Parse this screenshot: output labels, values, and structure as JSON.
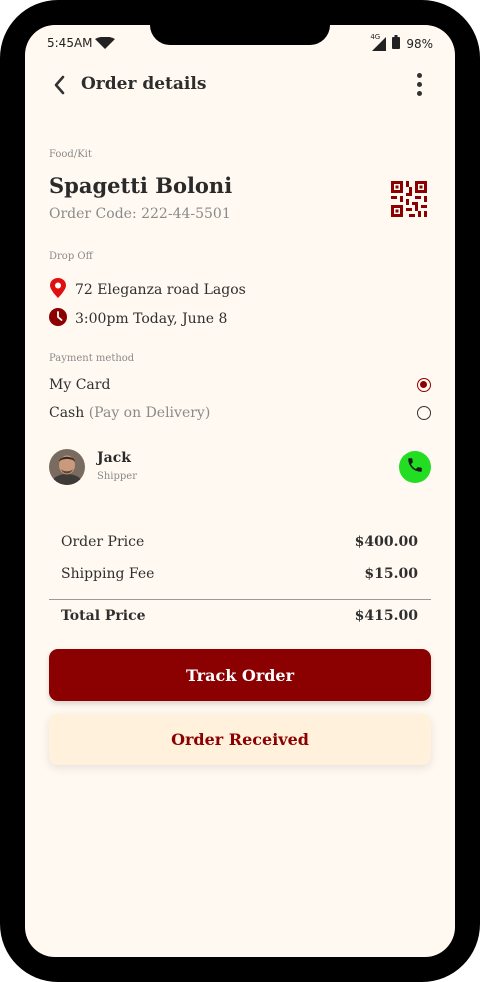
{
  "status_bar": {
    "time": "5:45AM",
    "network": "4G",
    "battery": "98%"
  },
  "header": {
    "title": "Order details"
  },
  "order": {
    "category_label": "Food/Kit",
    "name": "Spagetti Boloni",
    "code": "Order Code: 222-44-5501"
  },
  "drop_off": {
    "label": "Drop Off",
    "address": "72 Eleganza road Lagos",
    "time": "3:00pm Today, June 8"
  },
  "payment": {
    "label": "Payment method",
    "options": [
      {
        "label": "My Card",
        "suffix": "",
        "selected": true
      },
      {
        "label": "Cash",
        "suffix": "(Pay on Delivery)",
        "selected": false
      }
    ]
  },
  "shipper": {
    "name": "Jack",
    "role": "Shipper"
  },
  "summary": {
    "order_price_label": "Order Price",
    "order_price": "$400.00",
    "shipping_label": "Shipping Fee",
    "shipping": "$15.00",
    "total_label": "Total Price",
    "total": "$415.00"
  },
  "actions": {
    "track": "Track Order",
    "received": "Order Received"
  },
  "colors": {
    "accent": "#8B0000",
    "background": "#FFF9F1",
    "call_button": "#22DD22",
    "secondary_button": "#FFF1DC"
  },
  "icons": {
    "back": "chevron-left-icon",
    "more": "more-vertical-icon",
    "qr": "qr-code-icon",
    "location": "location-pin-icon",
    "clock": "clock-icon",
    "call": "phone-icon"
  }
}
